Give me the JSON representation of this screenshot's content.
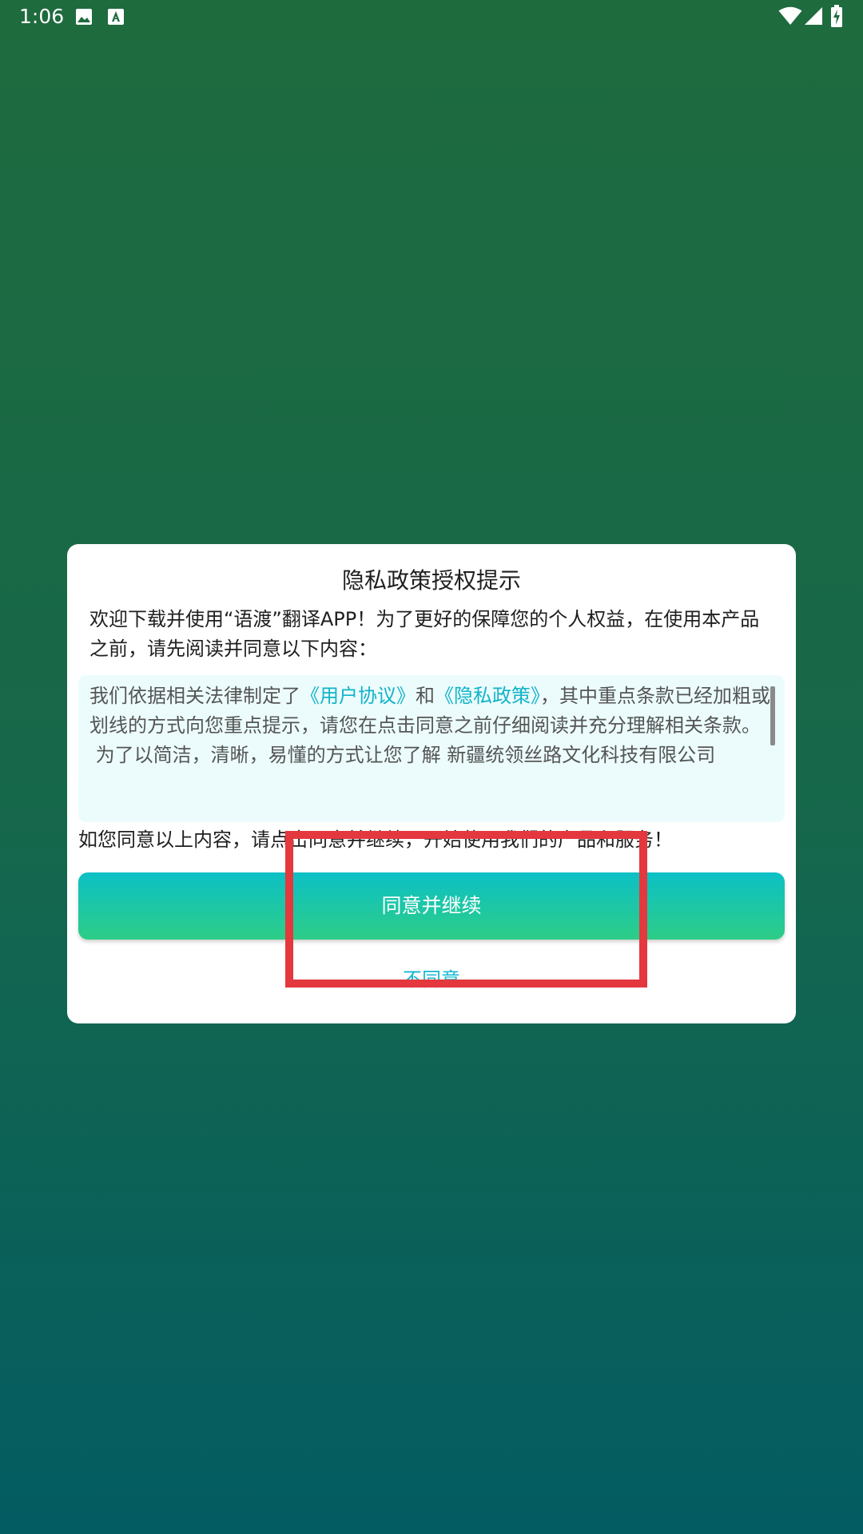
{
  "status_bar": {
    "time": "1:06",
    "icons": [
      "image-icon",
      "accessibility-icon",
      "wifi-icon",
      "cell-signal-icon",
      "battery-charging-icon"
    ]
  },
  "dialog": {
    "title": "隐私政策授权提示",
    "intro": "欢迎下载并使用“语渡”翻译APP！为了更好的保障您的个人权益，在使用本产品之前，请先阅读并同意以下内容：",
    "policy": {
      "text_before": "我们依据相关法律制定了",
      "user_agreement_link": "《用户协议》",
      "text_and": "和",
      "privacy_policy_link": "《隐私政策》",
      "text_after": "，其中重点条款已经加粗或划线的方式向您重点提示，请您在点击同意之前仔细阅读并充分理解相关条款。",
      "paragraph2": " 为了以简洁，清晰，易懂的方式让您了解 新疆统领丝路文化科技有限公司"
    },
    "consent": "如您同意以上内容，请点击同意并继续，开始使用我们的产品和服务！",
    "agree_button": "同意并继续",
    "disagree_link": "不同意"
  },
  "colors": {
    "background_top": "#1e6b3e",
    "background_bottom": "#035c62",
    "link": "#12b3c9",
    "button_start": "#0cc0c6",
    "button_end": "#2dcd86",
    "highlight": "#e3383e"
  }
}
